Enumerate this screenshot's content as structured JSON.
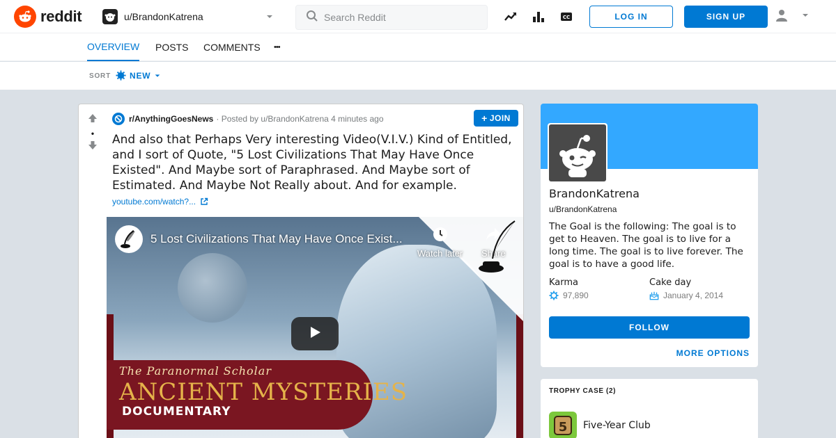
{
  "header": {
    "logo_text": "reddit",
    "community": "u/BrandonKatrena",
    "search_placeholder": "Search Reddit",
    "login_label": "LOG IN",
    "signup_label": "SIGN UP",
    "icons": [
      "trending-icon",
      "stats-icon",
      "cc-icon"
    ]
  },
  "tabs": [
    {
      "label": "OVERVIEW",
      "active": true
    },
    {
      "label": "POSTS",
      "active": false
    },
    {
      "label": "COMMENTS",
      "active": false
    },
    {
      "label": "•••",
      "active": false
    }
  ],
  "sort": {
    "label": "SORT",
    "value": "NEW"
  },
  "post": {
    "subreddit": "r/AnythingGoesNews",
    "posted_by": "· Posted by u/BrandonKatrena 4 minutes ago",
    "join_label": "JOIN",
    "title": "And also that Perhaps Very interesting Video(V.I.V.) Kind of Entitled, and I sort of Quote, \"5 Lost Civilizations That May Have Once Existed\". And Maybe sort of Paraphrased. And Maybe sort of Estimated. And Maybe Not Really about. And for example.",
    "link": "youtube.com/watch?...",
    "video": {
      "title": "5 Lost Civilizations That May Have Once Exist...",
      "watch_later": "Watch later",
      "share": "Share",
      "banner_script": "The Paranormal Scholar",
      "banner_main": "ANCIENT MYSTERIES",
      "banner_sub": "DOCUMENTARY"
    }
  },
  "profile": {
    "name": "BrandonKatrena",
    "handle": "u/BrandonKatrena",
    "description": "The Goal is the following: The goal is to get to Heaven. The goal is to live for a long time. The goal is to live forever. The goal is to have a good life.",
    "karma_label": "Karma",
    "karma_value": "97,890",
    "cakeday_label": "Cake day",
    "cakeday_value": "January 4, 2014",
    "follow_label": "FOLLOW",
    "more_options_label": "MORE OPTIONS"
  },
  "trophy_case": {
    "title": "TROPHY CASE (2)",
    "items": [
      {
        "name": "Five-Year Club",
        "badge": "5"
      }
    ]
  },
  "colors": {
    "brand": "#ff4500",
    "accent": "#0079d3",
    "banner": "#33a8ff",
    "background": "#dae0e6"
  }
}
